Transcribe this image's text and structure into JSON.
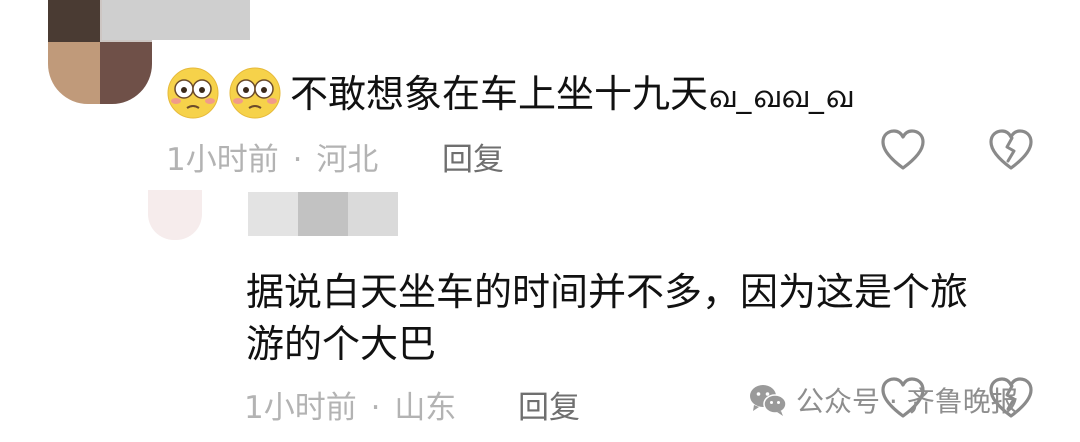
{
  "comment1": {
    "text": "不敢想象在车上坐十九天",
    "suffix": "ഖ_ഖഖ_ഖ",
    "time": "1小时前",
    "separator": "·",
    "location": "河北",
    "reply_label": "回复"
  },
  "comment2": {
    "text_line1": "据说白天坐车的时间并不多，因为这是个旅",
    "text_line2": "游的个大巴",
    "time": "1小时前",
    "separator": "·",
    "location": "山东",
    "reply_label": "回复"
  },
  "watermark": {
    "label": "公众号 · 齐鲁晚报"
  },
  "colors": {
    "text": "#111111",
    "meta": "#b3b3b3",
    "reply": "#6f6f6f",
    "icon": "#8a8a8a",
    "emoji_face": "#f6d24a"
  },
  "icons": {
    "like": "heart-outline-icon",
    "dislike": "broken-heart-icon",
    "emoji": "flushed-face-emoji-icon",
    "watermark_logo": "wechat-icon"
  }
}
